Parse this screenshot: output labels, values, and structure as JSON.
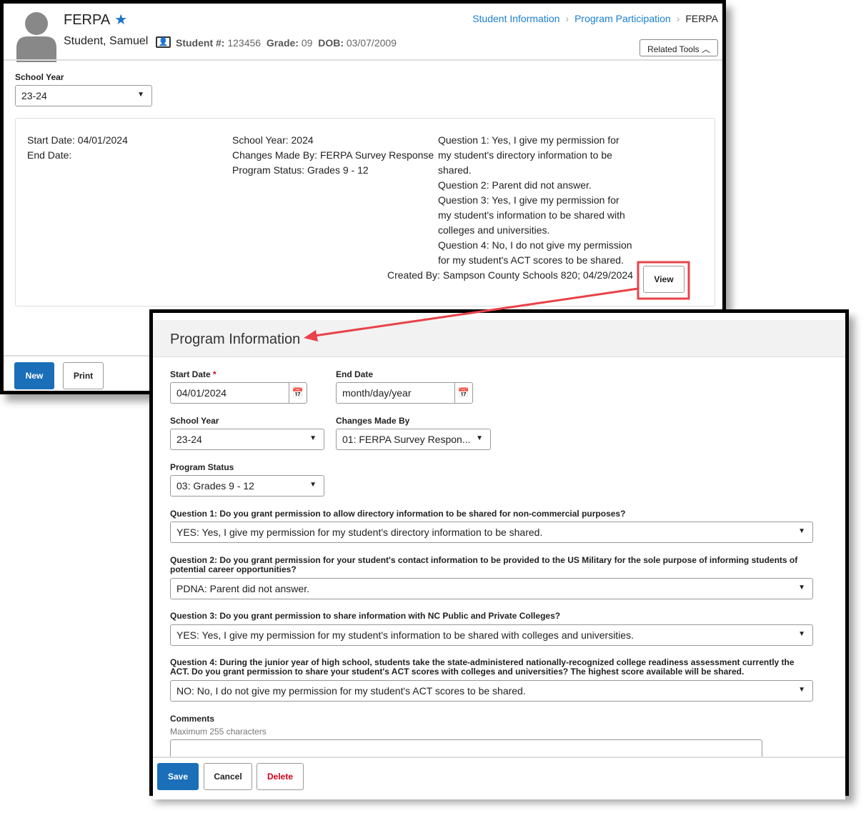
{
  "header": {
    "title": "FERPA",
    "student_name": "Student, Samuel",
    "student_num_label": "Student #:",
    "student_num": "123456",
    "grade_label": "Grade:",
    "grade": "09",
    "dob_label": "DOB:",
    "dob": "03/07/2009"
  },
  "breadcrumb": [
    "Student Information",
    "Program Participation",
    "FERPA"
  ],
  "related_tools": "Related Tools",
  "school_year": {
    "label": "School Year",
    "value": "23-24"
  },
  "summary": {
    "col1": [
      "Start Date: 04/01/2024",
      "End Date:"
    ],
    "col2": [
      "School Year: 2024",
      "Changes Made By: FERPA Survey Response",
      "Program Status: Grades 9 - 12"
    ],
    "col3": [
      "Question 1: Yes, I give my permission for",
      "my student's directory information to be",
      "shared.",
      "Question 2: Parent did not answer.",
      "Question 3: Yes, I give my permission for",
      "my student's information to be shared with",
      "colleges and universities.",
      "Question 4: No, I do not give my permission",
      "for my student's ACT scores to be shared."
    ],
    "created": "Created By: Sampson County Schools 820; 04/29/2024",
    "view": "View"
  },
  "footer1": {
    "new": "New",
    "print": "Print"
  },
  "form": {
    "title": "Program Information",
    "start_date": {
      "label": "Start Date",
      "required": "*",
      "value": "04/01/2024"
    },
    "end_date": {
      "label": "End Date",
      "placeholder": "month/day/year"
    },
    "school_year": {
      "label": "School Year",
      "value": "23-24"
    },
    "changes_made_by": {
      "label": "Changes Made By",
      "value": "01: FERPA Survey Respon..."
    },
    "program_status": {
      "label": "Program Status",
      "value": "03: Grades 9 - 12"
    },
    "questions": [
      {
        "label": "Question 1: Do you grant permission to allow directory information to be shared for non-commercial purposes?",
        "value": "YES: Yes, I give my permission for my student's directory information to be shared."
      },
      {
        "label": "Question 2: Do you grant permission for your student's contact information to be provided to the US Military for the sole purpose of informing students of potential career opportunities?",
        "value": "PDNA: Parent did not answer."
      },
      {
        "label": "Question 3: Do you grant permission to share information with NC Public and Private Colleges?",
        "value": "YES: Yes, I give my permission for my student's information to be shared with colleges and universities."
      },
      {
        "label": "Question 4: During the junior year of high school, students take the state-administered nationally-recognized college readiness assessment currently the ACT. Do you grant permission to share your student's ACT scores with colleges and universities? The highest score available will be shared.",
        "value": "NO: No, I do not give my permission for my student's ACT scores to be shared."
      }
    ],
    "comments": {
      "label": "Comments",
      "hint": "Maximum 255 characters"
    },
    "save": "Save",
    "cancel": "Cancel",
    "delete": "Delete"
  },
  "colors": {
    "accent": "#1a6fb8",
    "highlight": "#e8434a",
    "delete": "#d0021b"
  }
}
